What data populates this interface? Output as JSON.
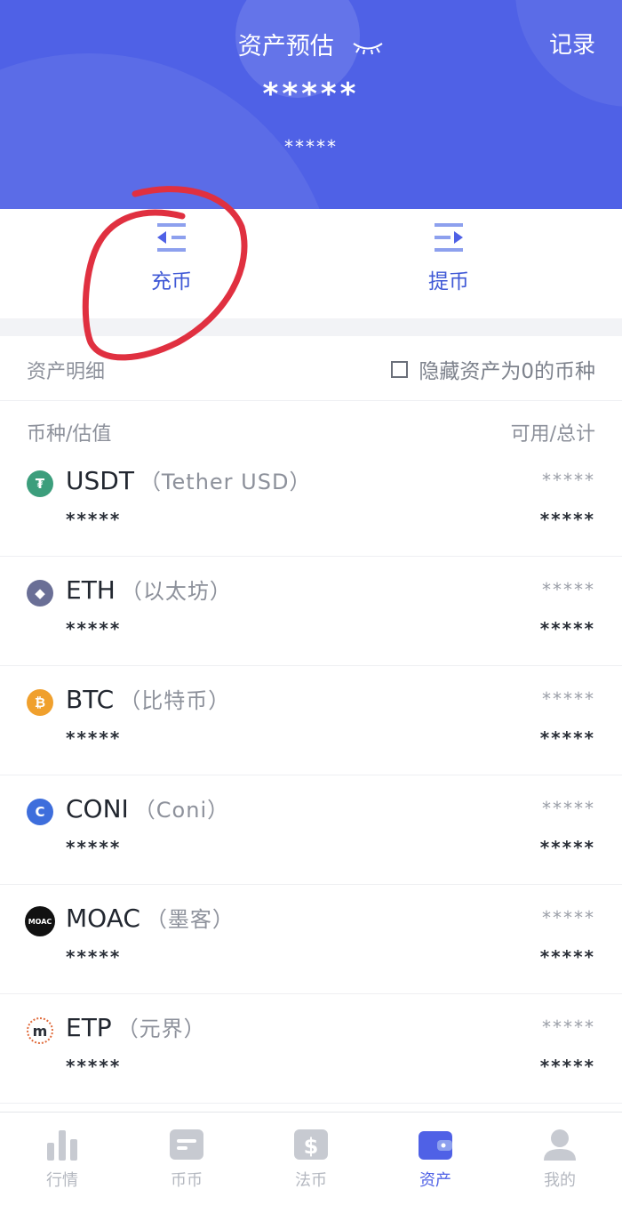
{
  "header": {
    "title": "资产预估",
    "record_label": "记录",
    "total_masked": "*****",
    "sub_masked": "*****"
  },
  "actions": {
    "deposit_label": "充币",
    "withdraw_label": "提币"
  },
  "list": {
    "section_title": "资产明细",
    "hide_zero_label": "隐藏资产为0的币种",
    "col_left": "币种/估值",
    "col_right": "可用/总计"
  },
  "coins": [
    {
      "symbol": "USDT",
      "full": "（Tether USD）",
      "available": "*****",
      "total": "*****",
      "value": "*****",
      "icon_color": "#3c9e7c",
      "icon_glyph": "₮"
    },
    {
      "symbol": "ETH",
      "full": "（以太坊）",
      "available": "*****",
      "total": "*****",
      "value": "*****",
      "icon_color": "#6a6f96",
      "icon_glyph": "◆"
    },
    {
      "symbol": "BTC",
      "full": "（比特币）",
      "available": "*****",
      "total": "*****",
      "value": "*****",
      "icon_color": "#f0a02d",
      "icon_glyph": "₿"
    },
    {
      "symbol": "CONI",
      "full": "（Coni）",
      "available": "*****",
      "total": "*****",
      "value": "*****",
      "icon_color": "#3e6edc",
      "icon_glyph": "C"
    },
    {
      "symbol": "MOAC",
      "full": "（墨客）",
      "available": "*****",
      "total": "*****",
      "value": "*****",
      "icon_color": "#111111",
      "icon_glyph": "MOAC"
    },
    {
      "symbol": "ETP",
      "full": "（元界）",
      "available": "*****",
      "total": "*****",
      "value": "*****",
      "icon_color": "#ffffff",
      "icon_glyph": "m"
    }
  ],
  "tabs": [
    {
      "label": "行情",
      "icon": "bar-chart-icon"
    },
    {
      "label": "币币",
      "icon": "card-icon"
    },
    {
      "label": "法币",
      "icon": "dollar-icon"
    },
    {
      "label": "资产",
      "icon": "wallet-icon",
      "active": true
    },
    {
      "label": "我的",
      "icon": "user-icon"
    }
  ],
  "colors": {
    "header_bg": "#4f61e6",
    "accent": "#4059d6",
    "annotation": "#e03040"
  }
}
